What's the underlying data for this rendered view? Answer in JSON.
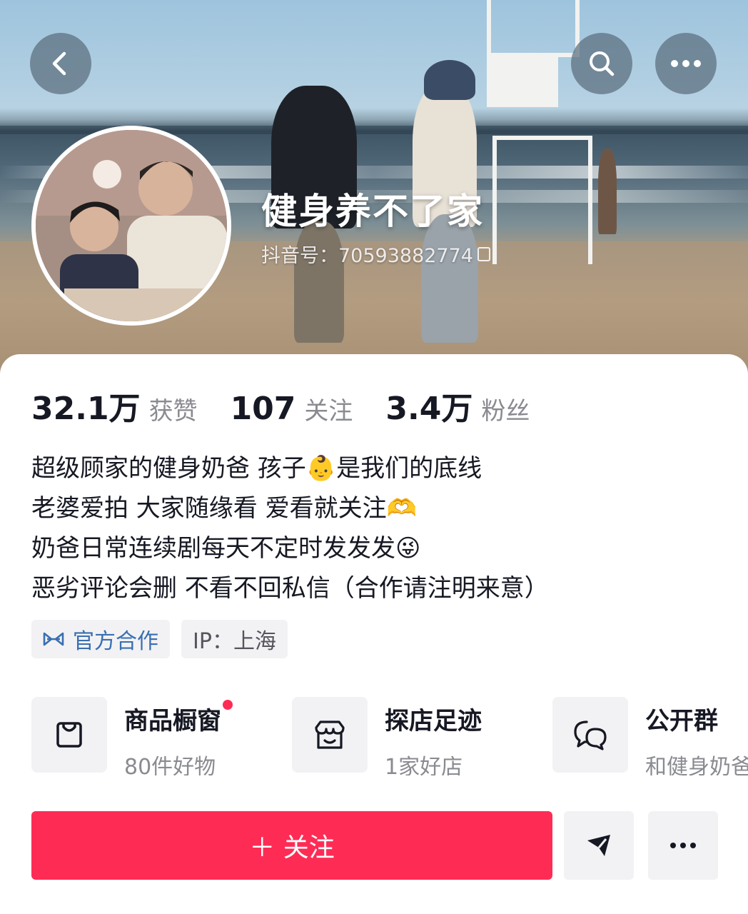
{
  "header": {
    "back_icon": "chevron-left-icon",
    "search_icon": "search-icon",
    "more_icon": "more-horizontal-icon"
  },
  "profile": {
    "nickname": "健身养不了家",
    "douyin_id": "抖音号：70593882774",
    "copy_icon": "copy-icon"
  },
  "stats": [
    {
      "value": "32.1万",
      "label": "获赞"
    },
    {
      "value": "107",
      "label": "关注"
    },
    {
      "value": "3.4万",
      "label": "粉丝"
    }
  ],
  "bio": [
    "超级顾家的健身奶爸 孩子👶是我们的底线",
    "老婆爱拍 大家随缘看 爱看就关注🫶",
    "奶爸日常连续剧每天不定时发发发😜",
    "恶劣评论会删 不看不回私信（合作请注明来意）"
  ],
  "tags": {
    "official": "官方合作",
    "official_icon": "handshake-icon",
    "ip": "IP：上海"
  },
  "entries": [
    {
      "title": "商品橱窗",
      "subtitle": "80件好物",
      "icon": "shopping-bag-icon",
      "has_dot": true
    },
    {
      "title": "探店足迹",
      "subtitle": "1家好店",
      "icon": "store-icon",
      "has_dot": false
    },
    {
      "title": "公开群",
      "subtitle": "和健身奶爸",
      "icon": "chat-bubbles-icon",
      "has_dot": false
    }
  ],
  "actions": {
    "follow_label": "＋ 关注",
    "share_icon": "send-icon",
    "more_icon": "more-horizontal-icon"
  },
  "colors": {
    "accent": "#fe2c55",
    "official_tag": "#3a6fb0",
    "secondary_text": "#8a8b91"
  }
}
